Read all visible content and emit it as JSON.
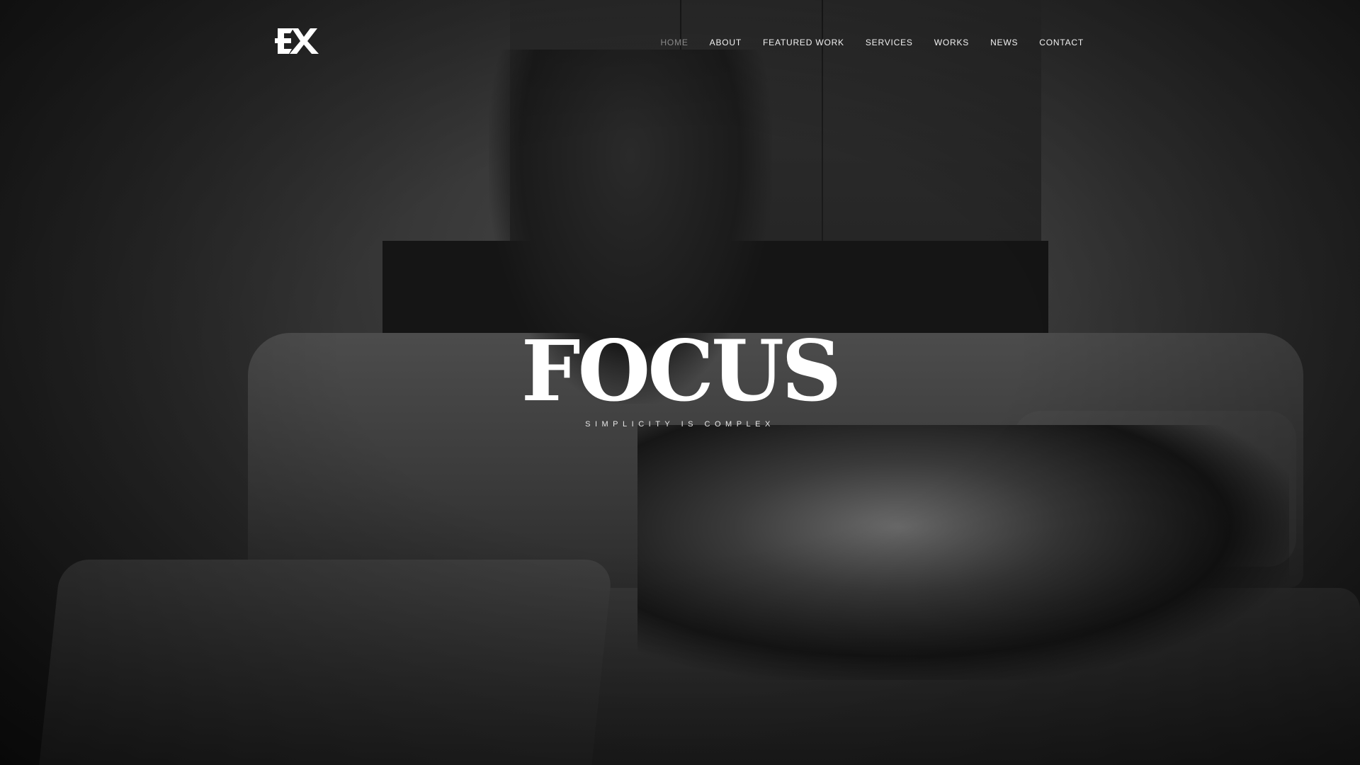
{
  "header": {
    "logo": {
      "text": "EX",
      "color": "#ffffff"
    },
    "nav": [
      {
        "label": "HOME",
        "active": true
      },
      {
        "label": "ABOUT",
        "active": false
      },
      {
        "label": "FEATURED WORK",
        "active": false
      },
      {
        "label": "SERVICES",
        "active": false
      },
      {
        "label": "WORKS",
        "active": false
      },
      {
        "label": "NEWS",
        "active": false
      },
      {
        "label": "CONTACT",
        "active": false
      }
    ]
  },
  "hero": {
    "title": "FOCUS",
    "subtitle": "SIMPLICITY IS COMPLEX"
  },
  "colors": {
    "text": "#ffffff",
    "nav_active": "#8a8a8a",
    "background": "#1a1a1a"
  }
}
